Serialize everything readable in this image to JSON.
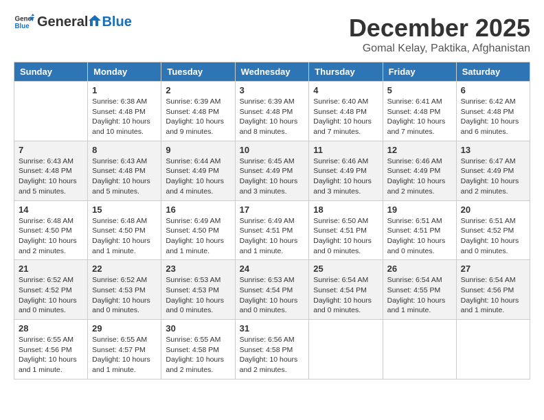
{
  "header": {
    "logo_general": "General",
    "logo_blue": "Blue",
    "month": "December 2025",
    "location": "Gomal Kelay, Paktika, Afghanistan"
  },
  "days_of_week": [
    "Sunday",
    "Monday",
    "Tuesday",
    "Wednesday",
    "Thursday",
    "Friday",
    "Saturday"
  ],
  "weeks": [
    [
      {
        "day": "",
        "text": ""
      },
      {
        "day": "1",
        "text": "Sunrise: 6:38 AM\nSunset: 4:48 PM\nDaylight: 10 hours\nand 10 minutes."
      },
      {
        "day": "2",
        "text": "Sunrise: 6:39 AM\nSunset: 4:48 PM\nDaylight: 10 hours\nand 9 minutes."
      },
      {
        "day": "3",
        "text": "Sunrise: 6:39 AM\nSunset: 4:48 PM\nDaylight: 10 hours\nand 8 minutes."
      },
      {
        "day": "4",
        "text": "Sunrise: 6:40 AM\nSunset: 4:48 PM\nDaylight: 10 hours\nand 7 minutes."
      },
      {
        "day": "5",
        "text": "Sunrise: 6:41 AM\nSunset: 4:48 PM\nDaylight: 10 hours\nand 7 minutes."
      },
      {
        "day": "6",
        "text": "Sunrise: 6:42 AM\nSunset: 4:48 PM\nDaylight: 10 hours\nand 6 minutes."
      }
    ],
    [
      {
        "day": "7",
        "text": "Sunrise: 6:43 AM\nSunset: 4:48 PM\nDaylight: 10 hours\nand 5 minutes."
      },
      {
        "day": "8",
        "text": "Sunrise: 6:43 AM\nSunset: 4:48 PM\nDaylight: 10 hours\nand 5 minutes."
      },
      {
        "day": "9",
        "text": "Sunrise: 6:44 AM\nSunset: 4:49 PM\nDaylight: 10 hours\nand 4 minutes."
      },
      {
        "day": "10",
        "text": "Sunrise: 6:45 AM\nSunset: 4:49 PM\nDaylight: 10 hours\nand 3 minutes."
      },
      {
        "day": "11",
        "text": "Sunrise: 6:46 AM\nSunset: 4:49 PM\nDaylight: 10 hours\nand 3 minutes."
      },
      {
        "day": "12",
        "text": "Sunrise: 6:46 AM\nSunset: 4:49 PM\nDaylight: 10 hours\nand 2 minutes."
      },
      {
        "day": "13",
        "text": "Sunrise: 6:47 AM\nSunset: 4:49 PM\nDaylight: 10 hours\nand 2 minutes."
      }
    ],
    [
      {
        "day": "14",
        "text": "Sunrise: 6:48 AM\nSunset: 4:50 PM\nDaylight: 10 hours\nand 2 minutes."
      },
      {
        "day": "15",
        "text": "Sunrise: 6:48 AM\nSunset: 4:50 PM\nDaylight: 10 hours\nand 1 minute."
      },
      {
        "day": "16",
        "text": "Sunrise: 6:49 AM\nSunset: 4:50 PM\nDaylight: 10 hours\nand 1 minute."
      },
      {
        "day": "17",
        "text": "Sunrise: 6:49 AM\nSunset: 4:51 PM\nDaylight: 10 hours\nand 1 minute."
      },
      {
        "day": "18",
        "text": "Sunrise: 6:50 AM\nSunset: 4:51 PM\nDaylight: 10 hours\nand 0 minutes."
      },
      {
        "day": "19",
        "text": "Sunrise: 6:51 AM\nSunset: 4:51 PM\nDaylight: 10 hours\nand 0 minutes."
      },
      {
        "day": "20",
        "text": "Sunrise: 6:51 AM\nSunset: 4:52 PM\nDaylight: 10 hours\nand 0 minutes."
      }
    ],
    [
      {
        "day": "21",
        "text": "Sunrise: 6:52 AM\nSunset: 4:52 PM\nDaylight: 10 hours\nand 0 minutes."
      },
      {
        "day": "22",
        "text": "Sunrise: 6:52 AM\nSunset: 4:53 PM\nDaylight: 10 hours\nand 0 minutes."
      },
      {
        "day": "23",
        "text": "Sunrise: 6:53 AM\nSunset: 4:53 PM\nDaylight: 10 hours\nand 0 minutes."
      },
      {
        "day": "24",
        "text": "Sunrise: 6:53 AM\nSunset: 4:54 PM\nDaylight: 10 hours\nand 0 minutes."
      },
      {
        "day": "25",
        "text": "Sunrise: 6:54 AM\nSunset: 4:54 PM\nDaylight: 10 hours\nand 0 minutes."
      },
      {
        "day": "26",
        "text": "Sunrise: 6:54 AM\nSunset: 4:55 PM\nDaylight: 10 hours\nand 1 minute."
      },
      {
        "day": "27",
        "text": "Sunrise: 6:54 AM\nSunset: 4:56 PM\nDaylight: 10 hours\nand 1 minute."
      }
    ],
    [
      {
        "day": "28",
        "text": "Sunrise: 6:55 AM\nSunset: 4:56 PM\nDaylight: 10 hours\nand 1 minute."
      },
      {
        "day": "29",
        "text": "Sunrise: 6:55 AM\nSunset: 4:57 PM\nDaylight: 10 hours\nand 1 minute."
      },
      {
        "day": "30",
        "text": "Sunrise: 6:55 AM\nSunset: 4:58 PM\nDaylight: 10 hours\nand 2 minutes."
      },
      {
        "day": "31",
        "text": "Sunrise: 6:56 AM\nSunset: 4:58 PM\nDaylight: 10 hours\nand 2 minutes."
      },
      {
        "day": "",
        "text": ""
      },
      {
        "day": "",
        "text": ""
      },
      {
        "day": "",
        "text": ""
      }
    ]
  ]
}
